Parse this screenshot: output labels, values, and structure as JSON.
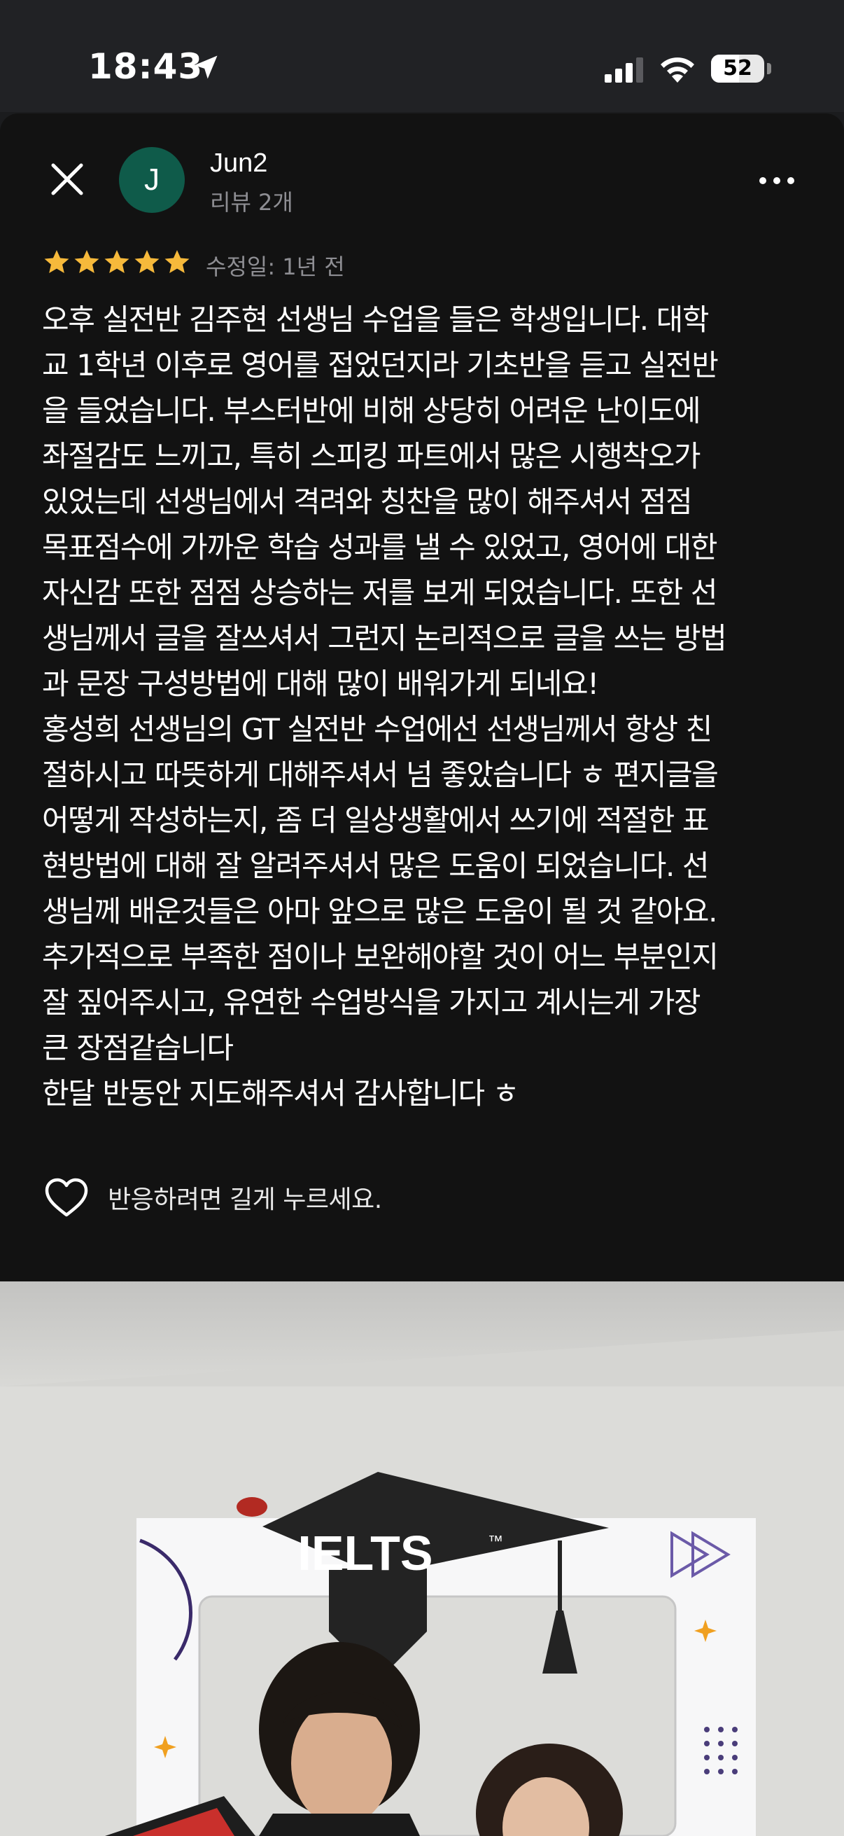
{
  "status_bar": {
    "time": "18:43",
    "battery": "52",
    "icons": [
      "location-arrow-icon",
      "cellular-signal-icon",
      "wifi-icon",
      "battery-icon"
    ]
  },
  "header": {
    "close_icon": "close-icon",
    "avatar_initial": "J",
    "avatar_color": "#0f5b4a",
    "user_name": "Jun2",
    "review_count": "리뷰 2개",
    "more_icon": "more-horizontal-icon"
  },
  "rating": {
    "stars": 5,
    "max": 5,
    "star_color": "#f6b93b",
    "edited": "수정일: 1년 전"
  },
  "review": {
    "lines": [
      "오후 실전반 김주현 선생님 수업을 들은 학생입니다. 대학",
      "교 1학년 이후로 영어를 접었던지라 기초반을 듣고 실전반",
      "을 들었습니다. 부스터반에 비해 상당히 어려운 난이도에",
      "좌절감도 느끼고, 특히 스피킹 파트에서 많은 시행착오가",
      "있었는데 선생님에서 격려와  칭찬을 많이 해주셔서 점점",
      "목표점수에 가까운 학습 성과를 낼 수 있었고, 영어에 대한",
      "자신감 또한 점점 상승하는 저를 보게 되었습니다. 또한 선",
      "생님께서 글을 잘쓰셔서 그런지 논리적으로 글을 쓰는 방법",
      "과 문장 구성방법에 대해 많이 배워가게 되네요!",
      "홍성희 선생님의 GT 실전반 수업에선 선생님께서 항상 친",
      "절하시고 따뜻하게 대해주셔서 넘 좋았습니다 ㅎ 편지글을",
      "어떻게 작성하는지, 좀 더 일상생활에서 쓰기에 적절한 표",
      "현방법에 대해 잘 알려주셔서 많은 도움이 되었습니다. 선",
      "생님께 배운것들은 아마 앞으로 많은 도움이 될 것 같아요.",
      "추가적으로 부족한 점이나 보완해야할 것이 어느 부분인지",
      "잘 짚어주시고, 유연한 수업방식을 가지고 계시는게 가장",
      "큰 장점같습니다",
      "한달 반동안 지도해주셔서 감사합니다 ㅎ"
    ]
  },
  "reaction": {
    "icon": "heart-outline-icon",
    "hint": "반응하려면 길게 누르세요."
  },
  "photo": {
    "sign_text": "IELTS",
    "trademark": "™"
  }
}
